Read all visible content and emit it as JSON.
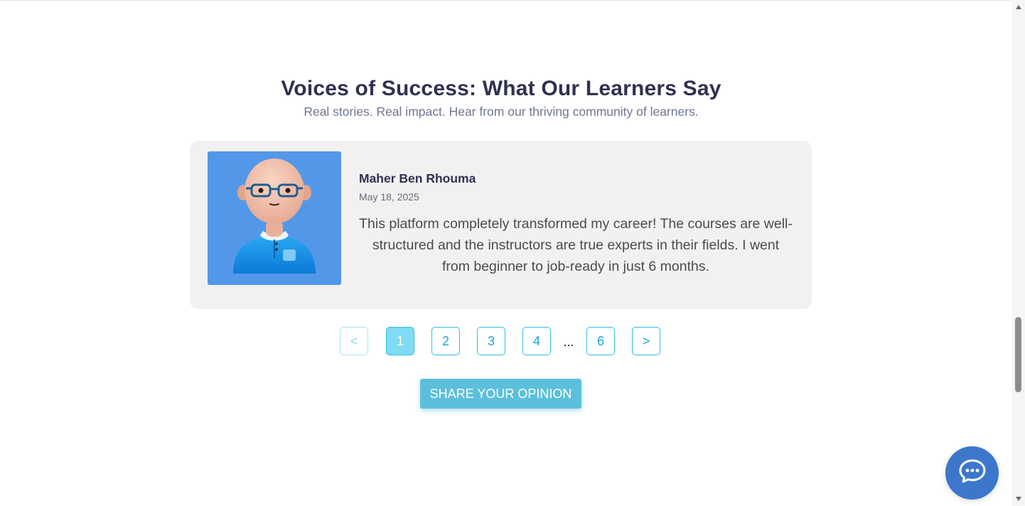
{
  "section": {
    "title": "Voices of Success: What Our Learners Say",
    "subtitle": "Real stories. Real impact. Hear from our thriving community of learners."
  },
  "testimonial": {
    "author_name": "Maher Ben Rhouma",
    "date": "May 18, 2025",
    "text": "This platform completely transformed my career! The courses are well-structured and the instructors are true experts in their fields. I went from beginner to job-ready in just 6 months.",
    "avatar_icon": "user-avatar-icon"
  },
  "pagination": {
    "prev_label": "<",
    "next_label": ">",
    "pages": [
      "1",
      "2",
      "3",
      "4",
      "6"
    ],
    "ellipsis": "...",
    "current_page": "1"
  },
  "actions": {
    "share_label": "SHARE YOUR OPINION"
  },
  "chat": {
    "icon": "chat-bubble-icon"
  },
  "colors": {
    "title": "#2f3151",
    "accent": "#2fbfe0",
    "share_button": "#5cbfdc",
    "chat_button": "#3d77cc",
    "card_background": "#f1f1f1",
    "avatar_background": "#5398e8"
  }
}
